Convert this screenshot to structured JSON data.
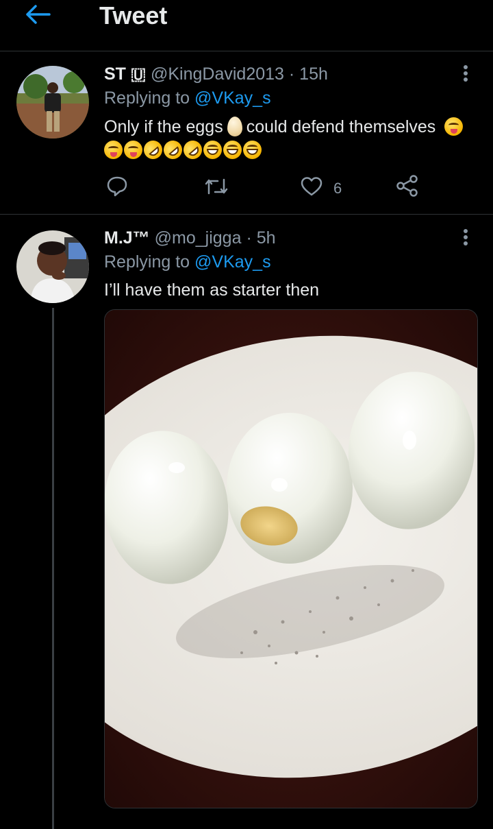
{
  "header": {
    "title": "Tweet",
    "back_icon": "arrow-left-icon",
    "accent": "#1d9bf0"
  },
  "tweets": [
    {
      "display_name": "ST 🇺",
      "handle": "@KingDavid2013",
      "time": "· 15h",
      "replying_prefix": "Replying to",
      "replying_to": "@VKay_s",
      "text_line1": "Only if the eggs",
      "text_line1_b": "could defend themselves",
      "emojis_line2": [
        "tongue",
        "tongue",
        "rofl",
        "rofl",
        "rofl",
        "smile",
        "smile",
        "smile"
      ],
      "actions": {
        "reply_icon": "comment-icon",
        "retweet_icon": "retweet-icon",
        "like_icon": "heart-icon",
        "like_count": "6",
        "share_icon": "share-icon"
      }
    },
    {
      "display_name": "M.J™",
      "handle": "@mo_jigga",
      "time": "· 5h",
      "replying_prefix": "Replying to",
      "replying_to": "@VKay_s",
      "text": "I’ll have them as starter then",
      "media": "photo of three peeled boiled eggs on a white plate with pepper"
    }
  ]
}
